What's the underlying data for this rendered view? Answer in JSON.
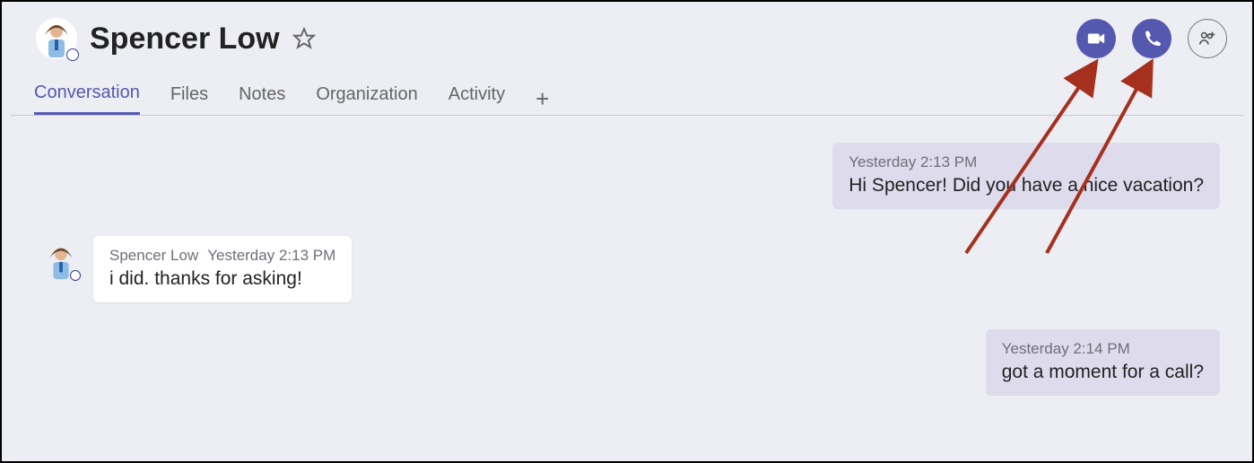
{
  "header": {
    "contact_name": "Spencer Low"
  },
  "tabs": [
    {
      "label": "Conversation",
      "active": true
    },
    {
      "label": "Files",
      "active": false
    },
    {
      "label": "Notes",
      "active": false
    },
    {
      "label": "Organization",
      "active": false
    },
    {
      "label": "Activity",
      "active": false
    }
  ],
  "messages": [
    {
      "direction": "sent",
      "timestamp": "Yesterday 2:13 PM",
      "body": "Hi Spencer! Did you have a nice vacation?"
    },
    {
      "direction": "recv",
      "sender": "Spencer Low",
      "timestamp": "Yesterday 2:13 PM",
      "body": "i did. thanks for asking!"
    },
    {
      "direction": "sent",
      "timestamp": "Yesterday 2:14 PM",
      "body": "got a moment for a call?"
    }
  ],
  "colors": {
    "accent": "#5558af",
    "sent_bubble": "#dedbed",
    "bg": "#eceef4",
    "annotation": "#a5301e"
  }
}
